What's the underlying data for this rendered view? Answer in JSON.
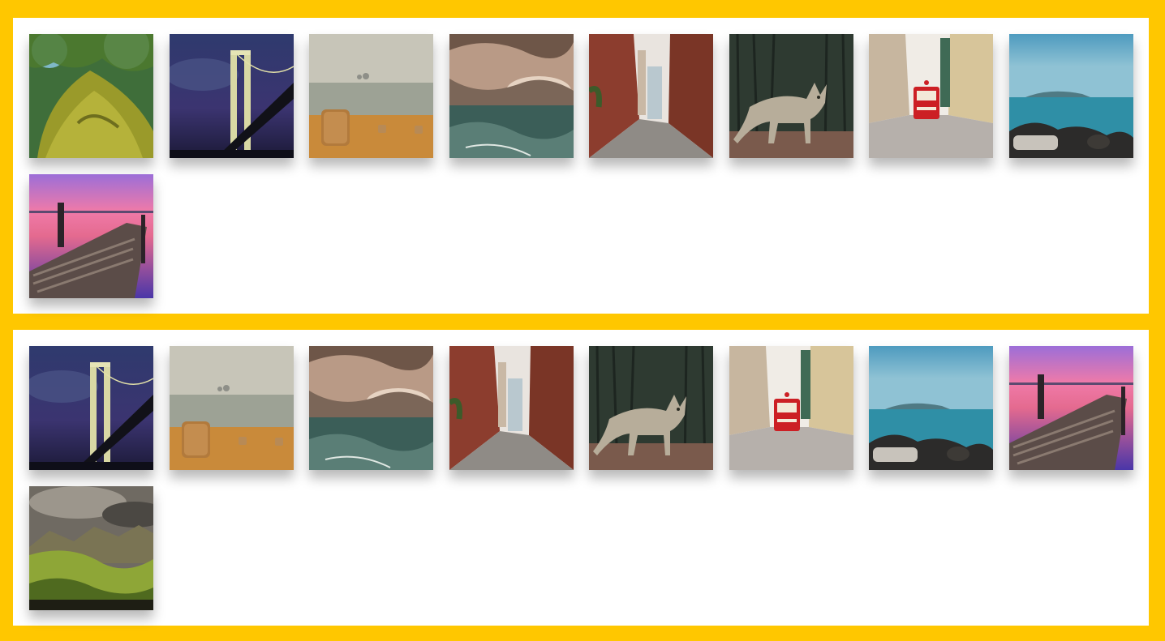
{
  "colors": {
    "frame": "#ffc700",
    "panel": "#ffffff"
  },
  "galleries": [
    {
      "tiles": [
        {
          "subject": "moss-trunk-image"
        },
        {
          "subject": "bridge-night-image"
        },
        {
          "subject": "hay-bales-image"
        },
        {
          "subject": "sea-sunset-image"
        },
        {
          "subject": "alley-image"
        },
        {
          "subject": "coyote-image"
        },
        {
          "subject": "red-tram-street-image"
        },
        {
          "subject": "coast-rocks-image"
        },
        {
          "subject": "pink-pier-image"
        }
      ]
    },
    {
      "tiles": [
        {
          "subject": "bridge-night-image"
        },
        {
          "subject": "hay-bales-image"
        },
        {
          "subject": "sea-sunset-image"
        },
        {
          "subject": "alley-image"
        },
        {
          "subject": "coyote-image"
        },
        {
          "subject": "red-tram-street-image"
        },
        {
          "subject": "coast-rocks-image"
        },
        {
          "subject": "pink-pier-image"
        },
        {
          "subject": "mountain-valley-image"
        }
      ]
    }
  ]
}
